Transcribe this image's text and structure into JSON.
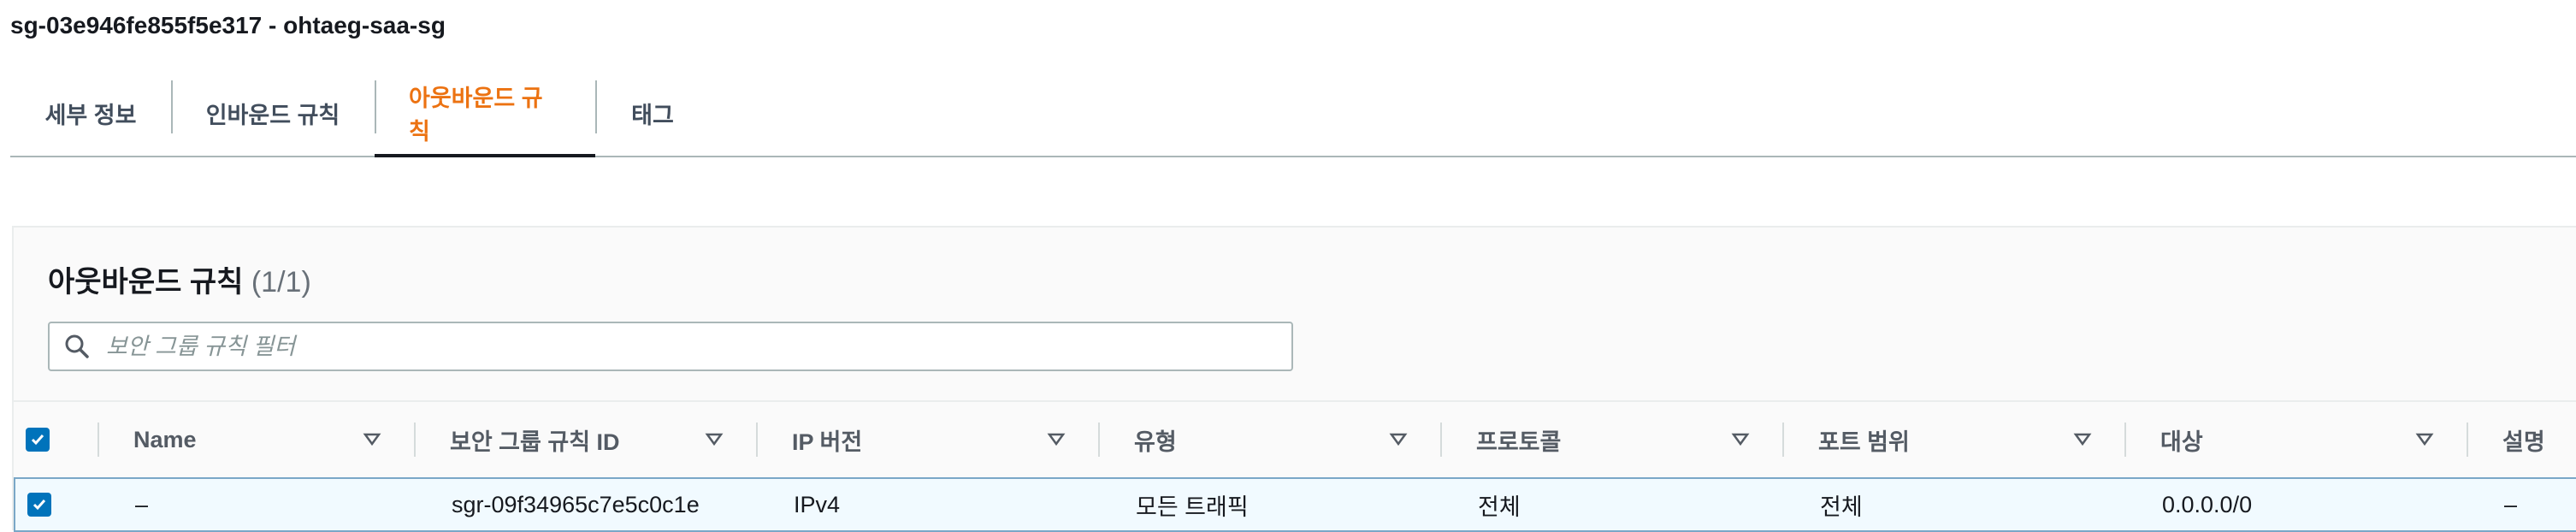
{
  "header": {
    "title": "sg-03e946fe855f5e317 - ohtaeg-saa-sg"
  },
  "tabs": [
    {
      "label": "세부 정보"
    },
    {
      "label": "인바운드 규칙"
    },
    {
      "label": "아웃바운드 규칙",
      "active": true
    },
    {
      "label": "태그"
    }
  ],
  "panel": {
    "title": "아웃바운드 규칙",
    "count": "(1/1)",
    "search": {
      "placeholder": "보안 그룹 규칙 필터",
      "value": ""
    }
  },
  "table": {
    "columns": [
      "Name",
      "보안 그룹 규칙 ID",
      "IP 버전",
      "유형",
      "프로토콜",
      "포트 범위",
      "대상",
      "설명"
    ],
    "rows": [
      {
        "selected": true,
        "cells": [
          "–",
          "sgr-09f34965c7e5c0c1e",
          "IPv4",
          "모든 트래픽",
          "전체",
          "전체",
          "0.0.0.0/0",
          "–"
        ]
      }
    ]
  },
  "colors": {
    "accent": "#ec7211",
    "checkbox": "#0073bb",
    "selected_row_bg": "#f1faff"
  },
  "icons": [
    "search-icon",
    "sort-caret-icon",
    "checkbox-checked-icon"
  ]
}
